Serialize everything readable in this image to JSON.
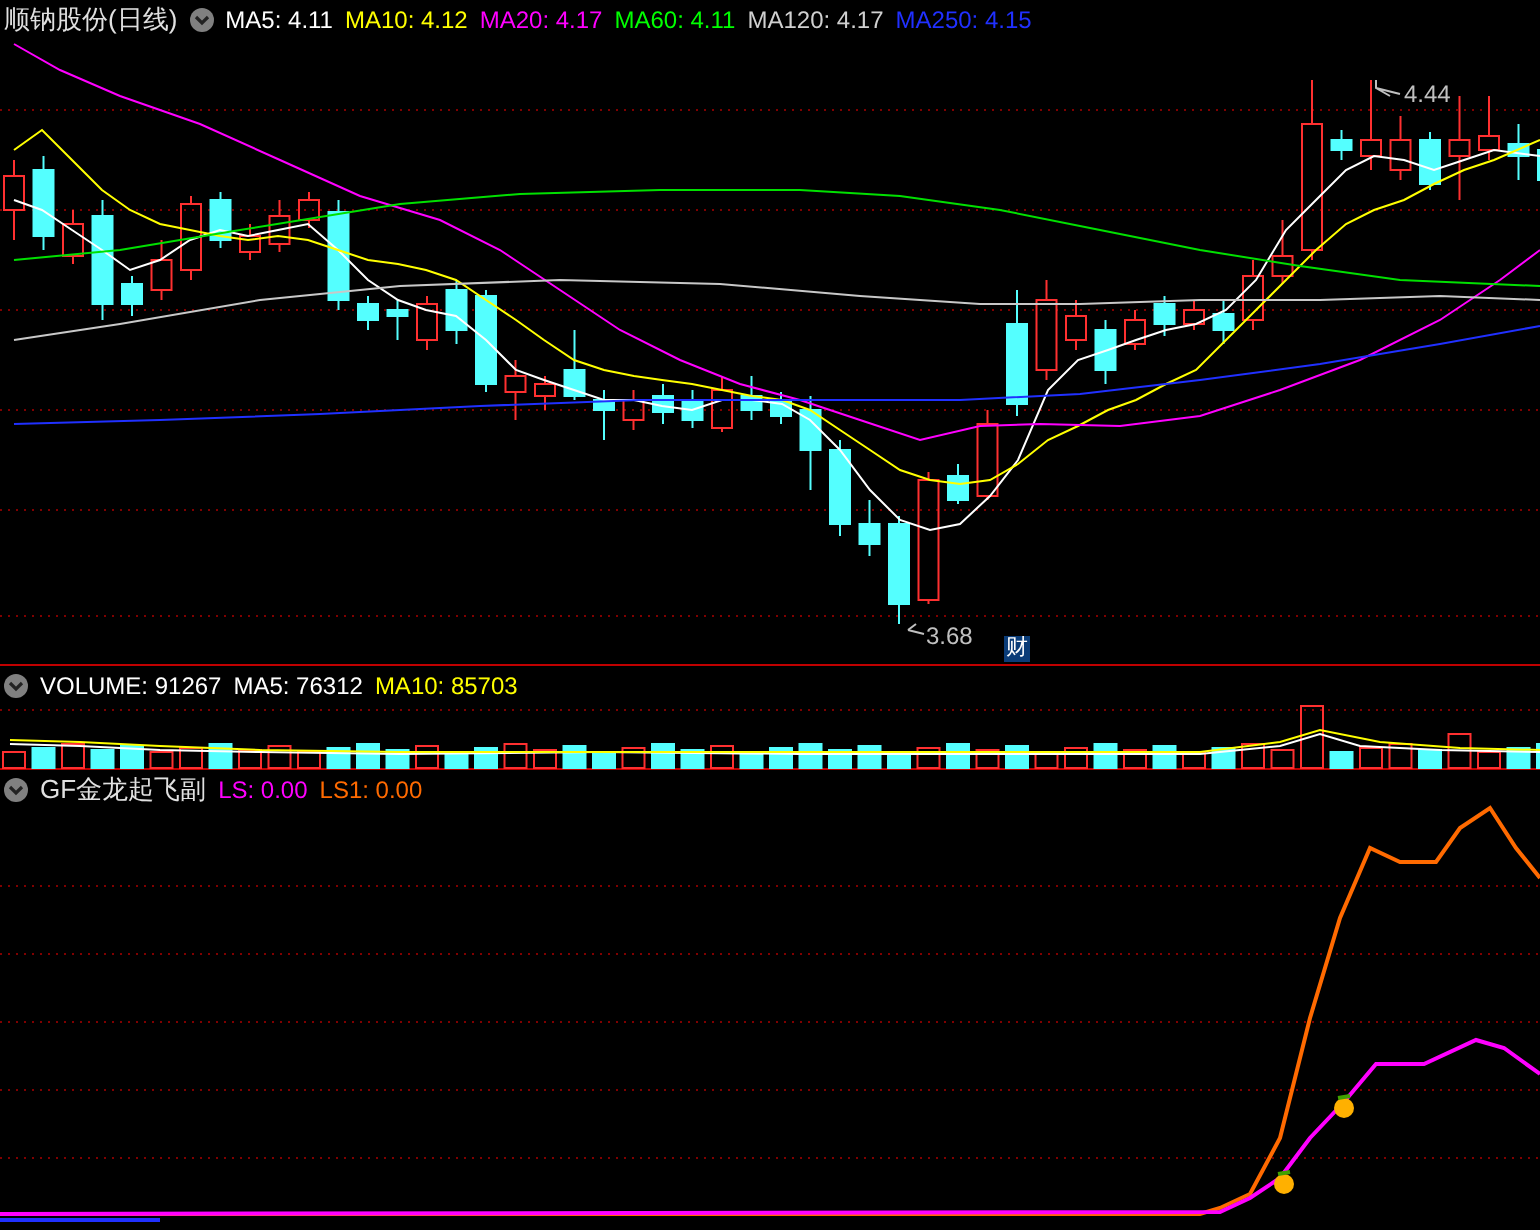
{
  "price_panel": {
    "title": "顺钠股份(日线)",
    "indicators": [
      {
        "text": "MA5: 4.11",
        "color": "#ffffff"
      },
      {
        "text": "MA10: 4.12",
        "color": "#ffff00"
      },
      {
        "text": "MA20: 4.17",
        "color": "#ff00ff"
      },
      {
        "text": "MA60: 4.11",
        "color": "#00ff00"
      },
      {
        "text": "MA120: 4.17",
        "color": "#d0d0d0"
      },
      {
        "text": "MA250: 4.15",
        "color": "#2030ff"
      }
    ],
    "high_label": "4.44",
    "low_label": "3.68",
    "badge": "财"
  },
  "volume_panel": {
    "indicators": [
      {
        "text": "VOLUME: 91267",
        "color": "#ffffff"
      },
      {
        "text": "MA5: 76312",
        "color": "#ffffff"
      },
      {
        "text": "MA10: 85703",
        "color": "#ffff00"
      }
    ]
  },
  "indicator_panel": {
    "title": "GF金龙起飞副",
    "indicators": [
      {
        "text": "LS: 0.00",
        "color": "#ff00ff"
      },
      {
        "text": "LS1: 0.00",
        "color": "#ff6a00"
      }
    ]
  }
}
